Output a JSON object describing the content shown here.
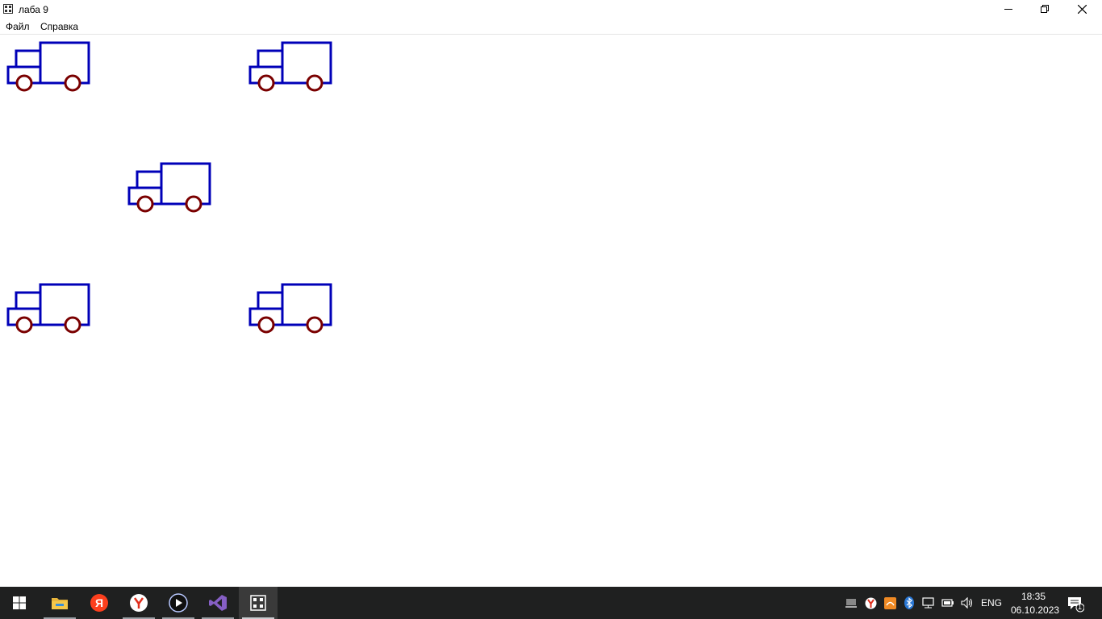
{
  "window": {
    "title": "лаба 9"
  },
  "menu": {
    "items": [
      {
        "label": "Файл"
      },
      {
        "label": "Справка"
      }
    ]
  },
  "canvas": {
    "truck_count": 5,
    "colors": {
      "body": "#0000b8",
      "wheel": "#7a0000"
    }
  },
  "taskbar": {
    "apps": [
      {
        "name": "file-explorer-icon",
        "running": true
      },
      {
        "name": "yandex-icon",
        "running": false
      },
      {
        "name": "yandex-browser-icon",
        "running": true
      },
      {
        "name": "media-player-icon",
        "running": true
      },
      {
        "name": "visual-studio-icon",
        "running": true
      },
      {
        "name": "lab-app-icon",
        "running": true,
        "active": true
      }
    ],
    "tray": {
      "language": "ENG",
      "notifications_count": "1"
    },
    "clock": {
      "time": "18:35",
      "date": "06.10.2023"
    }
  }
}
